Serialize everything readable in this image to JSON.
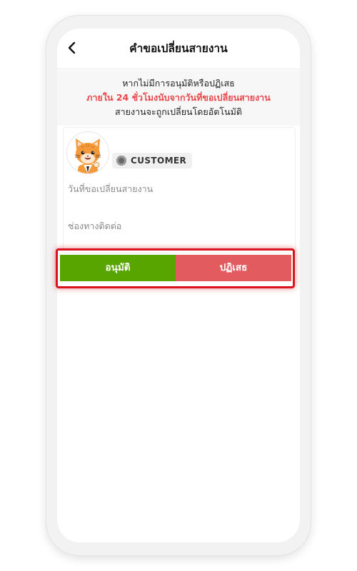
{
  "header": {
    "title": "คำขอเปลี่ยนสายงาน",
    "back_icon": "chevron-left-icon"
  },
  "notice": {
    "line1": "หากไม่มีการอนุมัติหรือปฏิเสธ",
    "line2": "ภายใน 24 ชั่วโมงนับจากวันที่ขอเปลี่ยนสายงาน",
    "line3": "สายงานจะถูกเปลี่ยนโดยอัตโนมัติ",
    "highlight_color": "#e8474c"
  },
  "request_card": {
    "avatar_icon": "cat-avatar",
    "role_badge": "CUSTOMER",
    "date_label": "วันที่ขอเปลี่ยนสายงาน",
    "contact_label": "ช่องทางติดต่อ"
  },
  "actions": {
    "approve_label": "อนุมัติ",
    "reject_label": "ปฏิเสธ",
    "approve_color": "#58a500",
    "reject_color": "#e25b5e",
    "highlight_color": "#d9141f"
  }
}
